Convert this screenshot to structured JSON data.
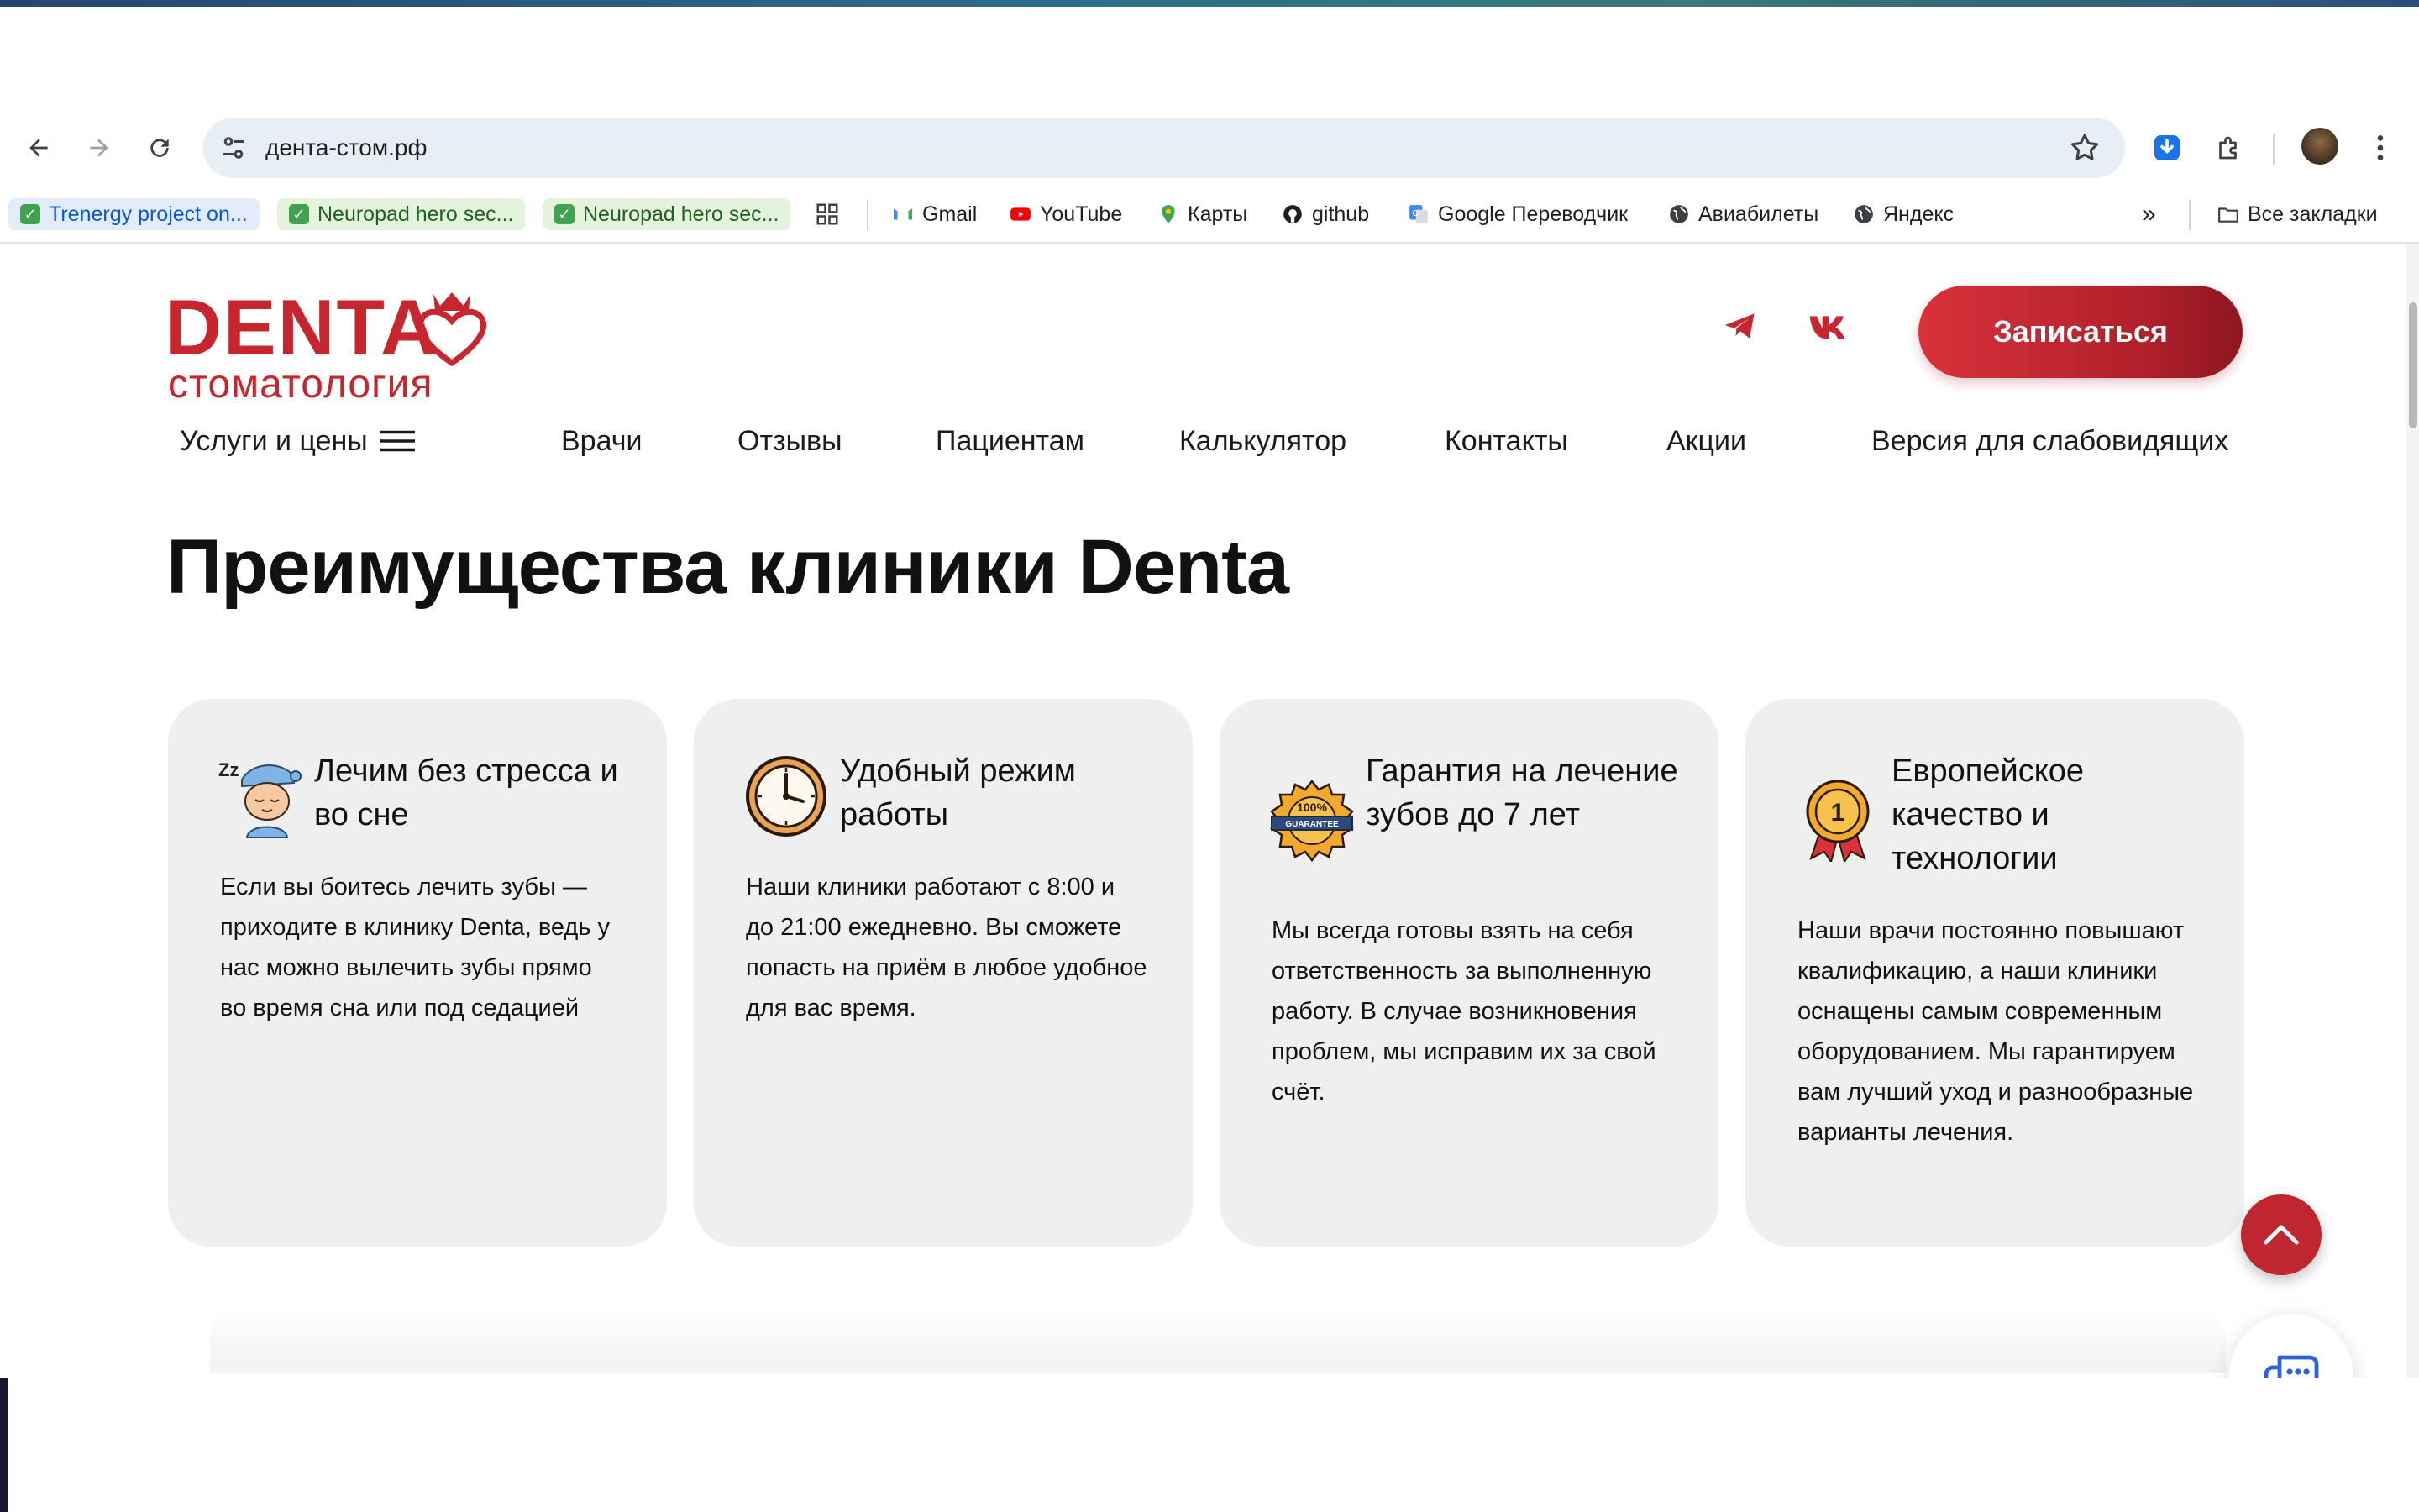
{
  "browser": {
    "url": "дента-стом.рф",
    "bookmarks": [
      {
        "label": "Trenergy project on...",
        "style": "blue"
      },
      {
        "label": "Neuropad hero sec...",
        "style": "green"
      },
      {
        "label": "Neuropad hero sec...",
        "style": "green"
      },
      {
        "label": "Gmail",
        "icon": "gmail-icon"
      },
      {
        "label": "YouTube",
        "icon": "youtube-icon"
      },
      {
        "label": "Карты",
        "icon": "maps-icon"
      },
      {
        "label": "github",
        "icon": "github-icon"
      },
      {
        "label": "Google Переводчик",
        "icon": "translate-icon"
      },
      {
        "label": "Авиабилеты",
        "icon": "globe-icon"
      },
      {
        "label": "Яндекс",
        "icon": "globe-icon"
      }
    ],
    "all_bookmarks": "Все закладки",
    "overflow": "»"
  },
  "site": {
    "logo_main": "DENTA",
    "logo_sub": "стоматология",
    "cta": "Записаться",
    "menu": [
      "Услуги и цены",
      "Врачи",
      "Отзывы",
      "Пациентам",
      "Калькулятор",
      "Контакты",
      "Акции",
      "Версия для слабовидящих"
    ],
    "heading": "Преимущества клиники Denta",
    "cards": [
      {
        "title": "Лечим без стресса и во сне",
        "text": "Если вы боитесь лечить зубы — приходите в клинику Denta, ведь у нас можно вылечить зубы прямо во время сна или под седацией",
        "icon": "sleeping-patient-icon"
      },
      {
        "title": "Удобный режим работы",
        "text": "Наши клиники работают с 8:00 и до 21:00 ежедневно. Вы сможете попасть на приём в любое удобное для вас время.",
        "icon": "clock-icon"
      },
      {
        "title": "Гарантия на лечение зубов до 7 лет",
        "text": "Мы всегда готовы взять на себя ответственность за выполненную работу. В случае возникновения проблем, мы исправим их за свой счёт.",
        "icon": "guarantee-badge-icon",
        "badge_text": "100% GUARANTEE"
      },
      {
        "title": "Европейское качество и технологии",
        "text": "Наши врачи постоянно повышают квалификацию, а наши клиники оснащены самым современным оборудованием. Мы гарантируем вам лучший уход и разнообразные варианты лечения.",
        "icon": "medal-icon",
        "badge_text": "1"
      }
    ]
  },
  "colors": {
    "brand_red": "#c8262f",
    "card_bg": "#efefef",
    "omnibox_bg": "#e8eef5"
  }
}
